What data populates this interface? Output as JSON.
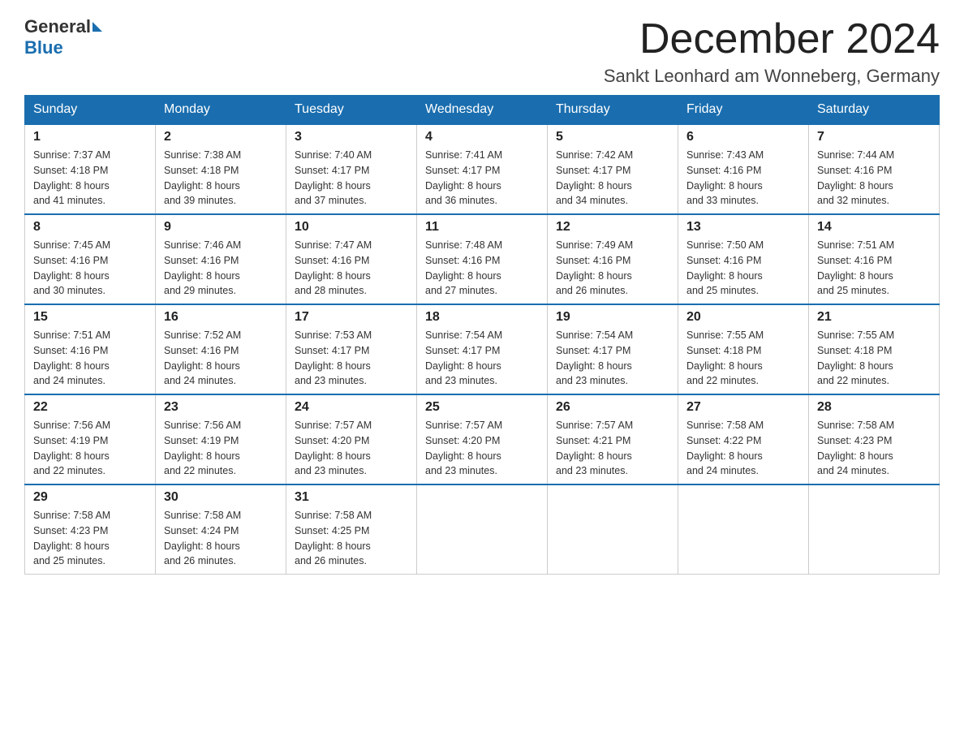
{
  "logo": {
    "general": "General",
    "blue": "Blue"
  },
  "title": "December 2024",
  "location": "Sankt Leonhard am Wonneberg, Germany",
  "headers": [
    "Sunday",
    "Monday",
    "Tuesday",
    "Wednesday",
    "Thursday",
    "Friday",
    "Saturday"
  ],
  "weeks": [
    [
      {
        "day": "1",
        "sunrise": "7:37 AM",
        "sunset": "4:18 PM",
        "daylight": "8 hours and 41 minutes."
      },
      {
        "day": "2",
        "sunrise": "7:38 AM",
        "sunset": "4:18 PM",
        "daylight": "8 hours and 39 minutes."
      },
      {
        "day": "3",
        "sunrise": "7:40 AM",
        "sunset": "4:17 PM",
        "daylight": "8 hours and 37 minutes."
      },
      {
        "day": "4",
        "sunrise": "7:41 AM",
        "sunset": "4:17 PM",
        "daylight": "8 hours and 36 minutes."
      },
      {
        "day": "5",
        "sunrise": "7:42 AM",
        "sunset": "4:17 PM",
        "daylight": "8 hours and 34 minutes."
      },
      {
        "day": "6",
        "sunrise": "7:43 AM",
        "sunset": "4:16 PM",
        "daylight": "8 hours and 33 minutes."
      },
      {
        "day": "7",
        "sunrise": "7:44 AM",
        "sunset": "4:16 PM",
        "daylight": "8 hours and 32 minutes."
      }
    ],
    [
      {
        "day": "8",
        "sunrise": "7:45 AM",
        "sunset": "4:16 PM",
        "daylight": "8 hours and 30 minutes."
      },
      {
        "day": "9",
        "sunrise": "7:46 AM",
        "sunset": "4:16 PM",
        "daylight": "8 hours and 29 minutes."
      },
      {
        "day": "10",
        "sunrise": "7:47 AM",
        "sunset": "4:16 PM",
        "daylight": "8 hours and 28 minutes."
      },
      {
        "day": "11",
        "sunrise": "7:48 AM",
        "sunset": "4:16 PM",
        "daylight": "8 hours and 27 minutes."
      },
      {
        "day": "12",
        "sunrise": "7:49 AM",
        "sunset": "4:16 PM",
        "daylight": "8 hours and 26 minutes."
      },
      {
        "day": "13",
        "sunrise": "7:50 AM",
        "sunset": "4:16 PM",
        "daylight": "8 hours and 25 minutes."
      },
      {
        "day": "14",
        "sunrise": "7:51 AM",
        "sunset": "4:16 PM",
        "daylight": "8 hours and 25 minutes."
      }
    ],
    [
      {
        "day": "15",
        "sunrise": "7:51 AM",
        "sunset": "4:16 PM",
        "daylight": "8 hours and 24 minutes."
      },
      {
        "day": "16",
        "sunrise": "7:52 AM",
        "sunset": "4:16 PM",
        "daylight": "8 hours and 24 minutes."
      },
      {
        "day": "17",
        "sunrise": "7:53 AM",
        "sunset": "4:17 PM",
        "daylight": "8 hours and 23 minutes."
      },
      {
        "day": "18",
        "sunrise": "7:54 AM",
        "sunset": "4:17 PM",
        "daylight": "8 hours and 23 minutes."
      },
      {
        "day": "19",
        "sunrise": "7:54 AM",
        "sunset": "4:17 PM",
        "daylight": "8 hours and 23 minutes."
      },
      {
        "day": "20",
        "sunrise": "7:55 AM",
        "sunset": "4:18 PM",
        "daylight": "8 hours and 22 minutes."
      },
      {
        "day": "21",
        "sunrise": "7:55 AM",
        "sunset": "4:18 PM",
        "daylight": "8 hours and 22 minutes."
      }
    ],
    [
      {
        "day": "22",
        "sunrise": "7:56 AM",
        "sunset": "4:19 PM",
        "daylight": "8 hours and 22 minutes."
      },
      {
        "day": "23",
        "sunrise": "7:56 AM",
        "sunset": "4:19 PM",
        "daylight": "8 hours and 22 minutes."
      },
      {
        "day": "24",
        "sunrise": "7:57 AM",
        "sunset": "4:20 PM",
        "daylight": "8 hours and 23 minutes."
      },
      {
        "day": "25",
        "sunrise": "7:57 AM",
        "sunset": "4:20 PM",
        "daylight": "8 hours and 23 minutes."
      },
      {
        "day": "26",
        "sunrise": "7:57 AM",
        "sunset": "4:21 PM",
        "daylight": "8 hours and 23 minutes."
      },
      {
        "day": "27",
        "sunrise": "7:58 AM",
        "sunset": "4:22 PM",
        "daylight": "8 hours and 24 minutes."
      },
      {
        "day": "28",
        "sunrise": "7:58 AM",
        "sunset": "4:23 PM",
        "daylight": "8 hours and 24 minutes."
      }
    ],
    [
      {
        "day": "29",
        "sunrise": "7:58 AM",
        "sunset": "4:23 PM",
        "daylight": "8 hours and 25 minutes."
      },
      {
        "day": "30",
        "sunrise": "7:58 AM",
        "sunset": "4:24 PM",
        "daylight": "8 hours and 26 minutes."
      },
      {
        "day": "31",
        "sunrise": "7:58 AM",
        "sunset": "4:25 PM",
        "daylight": "8 hours and 26 minutes."
      },
      null,
      null,
      null,
      null
    ]
  ],
  "labels": {
    "sunrise": "Sunrise:",
    "sunset": "Sunset:",
    "daylight": "Daylight:"
  }
}
